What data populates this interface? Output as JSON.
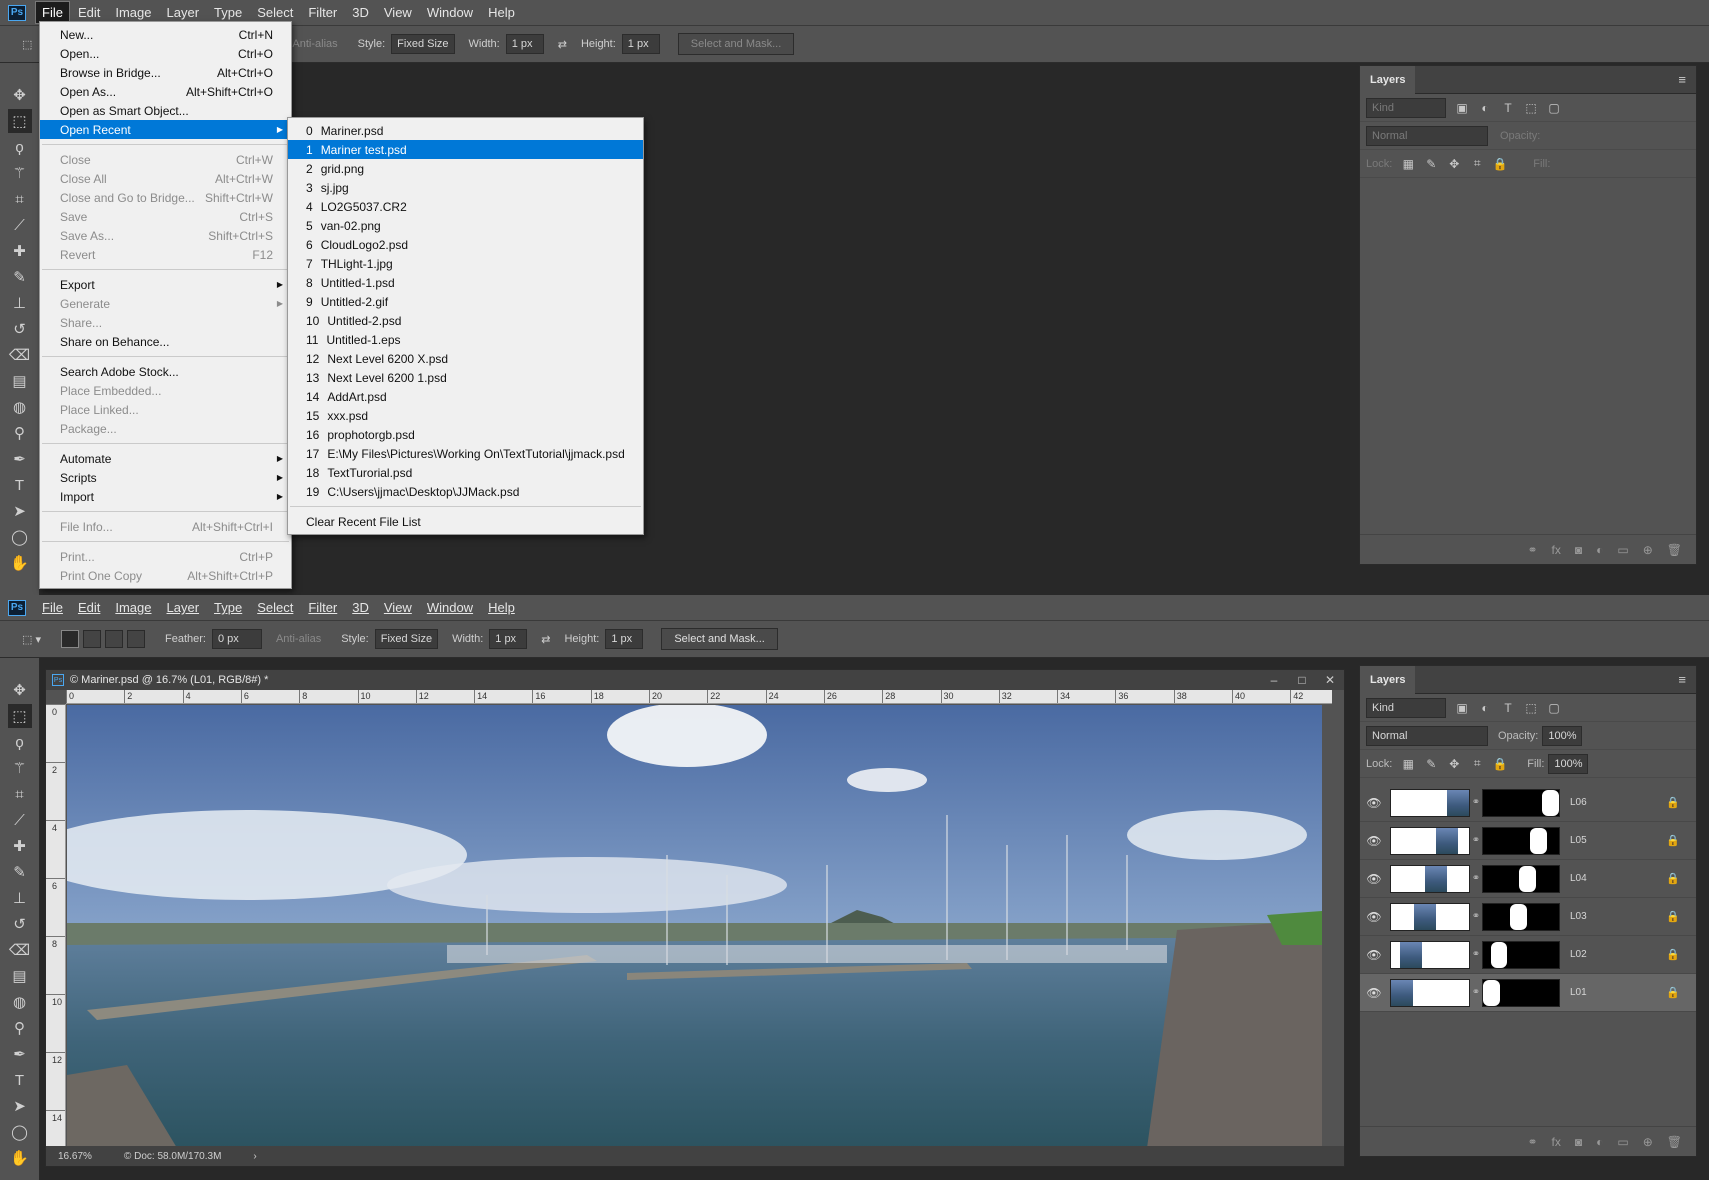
{
  "app": {
    "logo": "Ps"
  },
  "menubar": [
    "File",
    "Edit",
    "Image",
    "Layer",
    "Type",
    "Select",
    "Filter",
    "3D",
    "View",
    "Window",
    "Help"
  ],
  "options": {
    "feather_label": "Feather:",
    "feather_value": "0 px",
    "antialias": "Anti-alias",
    "style_label": "Style:",
    "style_value": "Fixed Size",
    "width_label": "Width:",
    "width_value": "1 px",
    "height_label": "Height:",
    "height_value": "1 px",
    "mask_button": "Select and Mask..."
  },
  "file_menu": [
    {
      "label": "New...",
      "shortcut": "Ctrl+N",
      "disabled": false
    },
    {
      "label": "Open...",
      "shortcut": "Ctrl+O",
      "disabled": false
    },
    {
      "label": "Browse in Bridge...",
      "shortcut": "Alt+Ctrl+O",
      "disabled": false
    },
    {
      "label": "Open As...",
      "shortcut": "Alt+Shift+Ctrl+O",
      "disabled": false
    },
    {
      "label": "Open as Smart Object...",
      "shortcut": "",
      "disabled": false
    },
    {
      "label": "Open Recent",
      "shortcut": "",
      "disabled": false,
      "submenu": true,
      "highlighted": true
    },
    {
      "sep": true
    },
    {
      "label": "Close",
      "shortcut": "Ctrl+W",
      "disabled": true
    },
    {
      "label": "Close All",
      "shortcut": "Alt+Ctrl+W",
      "disabled": true
    },
    {
      "label": "Close and Go to Bridge...",
      "shortcut": "Shift+Ctrl+W",
      "disabled": true
    },
    {
      "label": "Save",
      "shortcut": "Ctrl+S",
      "disabled": true
    },
    {
      "label": "Save As...",
      "shortcut": "Shift+Ctrl+S",
      "disabled": true
    },
    {
      "label": "Revert",
      "shortcut": "F12",
      "disabled": true
    },
    {
      "sep": true
    },
    {
      "label": "Export",
      "shortcut": "",
      "disabled": false,
      "submenu": true
    },
    {
      "label": "Generate",
      "shortcut": "",
      "disabled": true,
      "submenu": true
    },
    {
      "label": "Share...",
      "shortcut": "",
      "disabled": true
    },
    {
      "label": "Share on Behance...",
      "shortcut": "",
      "disabled": false
    },
    {
      "sep": true
    },
    {
      "label": "Search Adobe Stock...",
      "shortcut": "",
      "disabled": false
    },
    {
      "label": "Place Embedded...",
      "shortcut": "",
      "disabled": true
    },
    {
      "label": "Place Linked...",
      "shortcut": "",
      "disabled": true
    },
    {
      "label": "Package...",
      "shortcut": "",
      "disabled": true
    },
    {
      "sep": true
    },
    {
      "label": "Automate",
      "shortcut": "",
      "disabled": false,
      "submenu": true
    },
    {
      "label": "Scripts",
      "shortcut": "",
      "disabled": false,
      "submenu": true
    },
    {
      "label": "Import",
      "shortcut": "",
      "disabled": false,
      "submenu": true
    },
    {
      "sep": true
    },
    {
      "label": "File Info...",
      "shortcut": "Alt+Shift+Ctrl+I",
      "disabled": true
    },
    {
      "sep": true
    },
    {
      "label": "Print...",
      "shortcut": "Ctrl+P",
      "disabled": true
    },
    {
      "label": "Print One Copy",
      "shortcut": "Alt+Shift+Ctrl+P",
      "disabled": true
    }
  ],
  "recent_files": [
    "Mariner.psd",
    "Mariner test.psd",
    "grid.png",
    "sj.jpg",
    "LO2G5037.CR2",
    "van-02.png",
    "CloudLogo2.psd",
    "THLight-1.jpg",
    "Untitled-1.psd",
    "Untitled-2.gif",
    "Untitled-2.psd",
    "Untitled-1.eps",
    "Next Level 6200 X.psd",
    "Next Level 6200 1.psd",
    "AddArt.psd",
    "xxx.psd",
    "prophotorgb.psd",
    "E:\\My Files\\Pictures\\Working On\\TextTutorial\\jjmack.psd",
    "TextTurorial.psd",
    "C:\\Users\\jjmac\\Desktop\\JJMack.psd"
  ],
  "recent_highlight": 1,
  "recent_clear": "Clear Recent File List",
  "layers_panel": {
    "title": "Layers",
    "kind": "Kind",
    "blend": "Normal",
    "opacity_label": "Opacity:",
    "opacity": "100%",
    "lock_label": "Lock:",
    "fill_label": "Fill:",
    "fill": "100%"
  },
  "layers": [
    {
      "name": "L06",
      "photo_pos": 0.72,
      "mask_left": 0.78,
      "mask_width": 0.22
    },
    {
      "name": "L05",
      "photo_pos": 0.58,
      "mask_left": 0.62,
      "mask_width": 0.22
    },
    {
      "name": "L04",
      "photo_pos": 0.44,
      "mask_left": 0.48,
      "mask_width": 0.22
    },
    {
      "name": "L03",
      "photo_pos": 0.3,
      "mask_left": 0.36,
      "mask_width": 0.22
    },
    {
      "name": "L02",
      "photo_pos": 0.12,
      "mask_left": 0.1,
      "mask_width": 0.22
    },
    {
      "name": "L01",
      "photo_pos": 0.0,
      "mask_left": 0.0,
      "mask_width": 0.22
    }
  ],
  "selected_layer": "L01",
  "document": {
    "title": "© Mariner.psd @ 16.7% (L01, RGB/8#) *",
    "zoom": "16.67%",
    "doc_info": "© Doc: 58.0M/170.3M"
  },
  "ruler_h": [
    "0",
    "2",
    "4",
    "6",
    "8",
    "10",
    "12",
    "14",
    "16",
    "18",
    "20",
    "22",
    "24",
    "26",
    "28",
    "30",
    "32",
    "34",
    "36",
    "38",
    "40",
    "42"
  ],
  "ruler_v": [
    "0",
    "2",
    "4",
    "6",
    "8",
    "10",
    "12",
    "14"
  ]
}
